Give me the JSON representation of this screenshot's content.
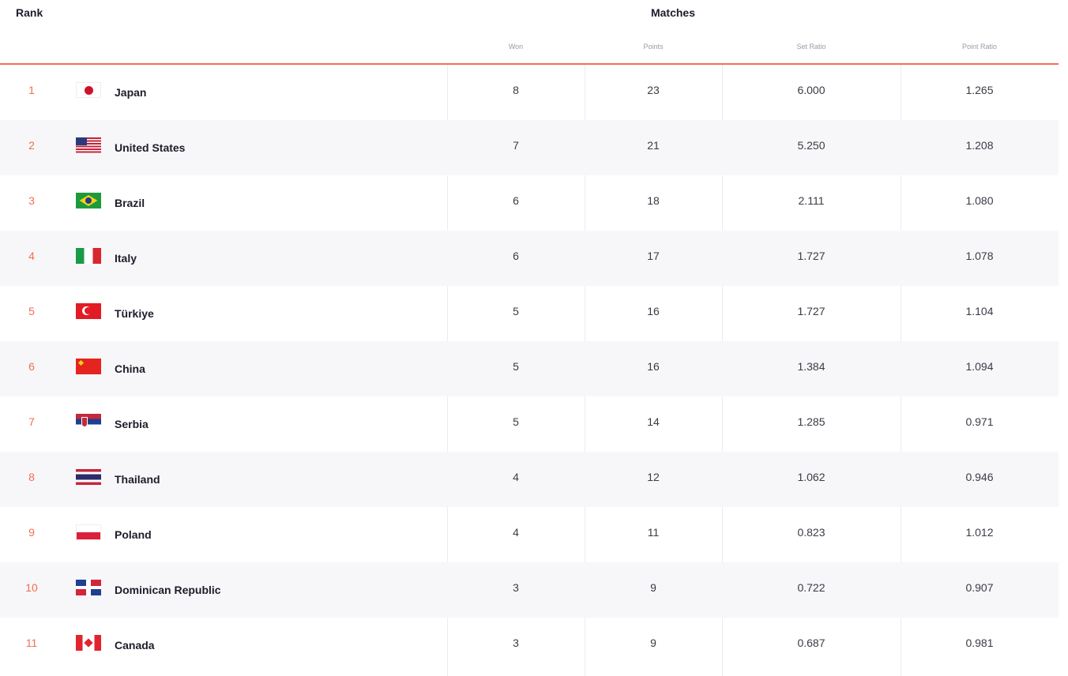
{
  "header": {
    "rank_label": "Rank",
    "matches_label": "Matches",
    "columns": {
      "won": "Won",
      "points": "Points",
      "set_ratio": "Set Ratio",
      "point_ratio": "Point Ratio"
    }
  },
  "accent_color": "#f26f4f",
  "rows": [
    {
      "rank": "1",
      "team": "Japan",
      "flag": "japan-flag-icon",
      "won": "8",
      "points": "23",
      "set_ratio": "6.000",
      "point_ratio": "1.265"
    },
    {
      "rank": "2",
      "team": "United States",
      "flag": "united-states-flag-icon",
      "won": "7",
      "points": "21",
      "set_ratio": "5.250",
      "point_ratio": "1.208"
    },
    {
      "rank": "3",
      "team": "Brazil",
      "flag": "brazil-flag-icon",
      "won": "6",
      "points": "18",
      "set_ratio": "2.111",
      "point_ratio": "1.080"
    },
    {
      "rank": "4",
      "team": "Italy",
      "flag": "italy-flag-icon",
      "won": "6",
      "points": "17",
      "set_ratio": "1.727",
      "point_ratio": "1.078"
    },
    {
      "rank": "5",
      "team": "Türkiye",
      "flag": "turkiye-flag-icon",
      "won": "5",
      "points": "16",
      "set_ratio": "1.727",
      "point_ratio": "1.104"
    },
    {
      "rank": "6",
      "team": "China",
      "flag": "china-flag-icon",
      "won": "5",
      "points": "16",
      "set_ratio": "1.384",
      "point_ratio": "1.094"
    },
    {
      "rank": "7",
      "team": "Serbia",
      "flag": "serbia-flag-icon",
      "won": "5",
      "points": "14",
      "set_ratio": "1.285",
      "point_ratio": "0.971"
    },
    {
      "rank": "8",
      "team": "Thailand",
      "flag": "thailand-flag-icon",
      "won": "4",
      "points": "12",
      "set_ratio": "1.062",
      "point_ratio": "0.946"
    },
    {
      "rank": "9",
      "team": "Poland",
      "flag": "poland-flag-icon",
      "won": "4",
      "points": "11",
      "set_ratio": "0.823",
      "point_ratio": "1.012"
    },
    {
      "rank": "10",
      "team": "Dominican Republic",
      "flag": "dominican-republic-flag-icon",
      "won": "3",
      "points": "9",
      "set_ratio": "0.722",
      "point_ratio": "0.907"
    },
    {
      "rank": "11",
      "team": "Canada",
      "flag": "canada-flag-icon",
      "won": "3",
      "points": "9",
      "set_ratio": "0.687",
      "point_ratio": "0.981"
    }
  ]
}
